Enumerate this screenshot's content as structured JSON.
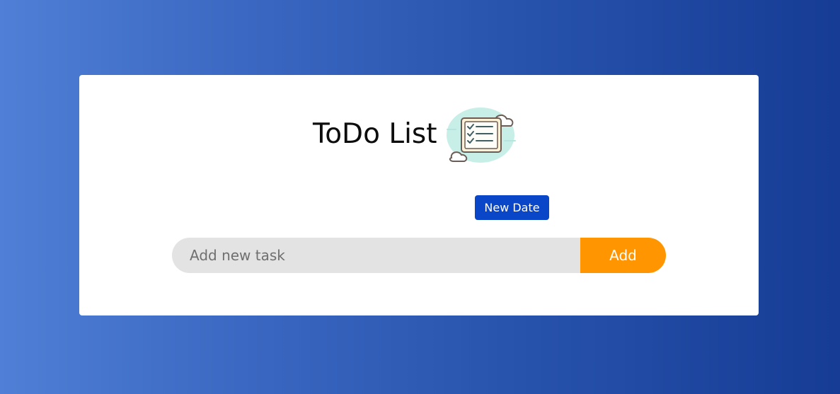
{
  "app": {
    "title": "ToDo List"
  },
  "controls": {
    "date_button_label": "New Date",
    "task_placeholder": "Add new task",
    "add_button_label": "Add"
  },
  "icons": {
    "title_icon": "checklist-cloud-icon"
  },
  "colors": {
    "background_start": "#4f7fd6",
    "background_end": "#163c95",
    "date_button": "#0a46c8",
    "add_button": "#ff9500",
    "input_background": "#e3e3e3"
  }
}
